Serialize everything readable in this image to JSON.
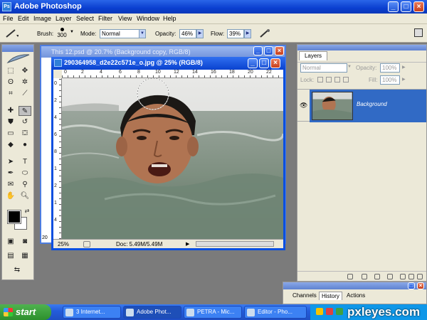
{
  "app": {
    "title": "Adobe Photoshop",
    "icon": "ps-logo-icon"
  },
  "window_controls": {
    "minimize": "_",
    "maximize": "□",
    "close": "×"
  },
  "menu": [
    "File",
    "Edit",
    "Image",
    "Layer",
    "Select",
    "Filter",
    "View",
    "Window",
    "Help"
  ],
  "options": {
    "brush_label": "Brush:",
    "brush_size": "300",
    "mode_label": "Mode:",
    "mode_value": "Normal",
    "opacity_label": "Opacity:",
    "opacity_value": "46%",
    "flow_label": "Flow:",
    "flow_value": "39%"
  },
  "background_doc": {
    "title": "This 12.psd @ 20.7% (Background copy, RGB/8)",
    "edge_value": "20"
  },
  "document": {
    "title": "290364958_d2e22c571e_o.jpg @ 25% (RGB/8)",
    "zoom": "25%",
    "doc_size": "Doc: 5.49M/5.49M",
    "ruler_top": [
      "0",
      "2",
      "4",
      "6",
      "8",
      "10",
      "12",
      "14",
      "16",
      "18",
      "20",
      "22"
    ],
    "ruler_left": [
      "0",
      "2",
      "4",
      "6",
      "8",
      "1",
      "2",
      "1",
      "4"
    ]
  },
  "layers": {
    "tab": "Layers",
    "blend_mode": "Normal",
    "opacity_label": "Opacity:",
    "opacity_value": "100%",
    "lock_label": "Lock:",
    "fill_label": "Fill:",
    "fill_value": "100%",
    "layer_name": "Background"
  },
  "history": {
    "tabs": [
      "Channels",
      "History",
      "Actions"
    ],
    "active": "History"
  },
  "taskbar": {
    "start": "start",
    "tasks": [
      "3 Internet...",
      "Adobe Phot...",
      "PETRA - Mic...",
      "Editor - Pho..."
    ]
  },
  "watermark": "pxleyes.com"
}
